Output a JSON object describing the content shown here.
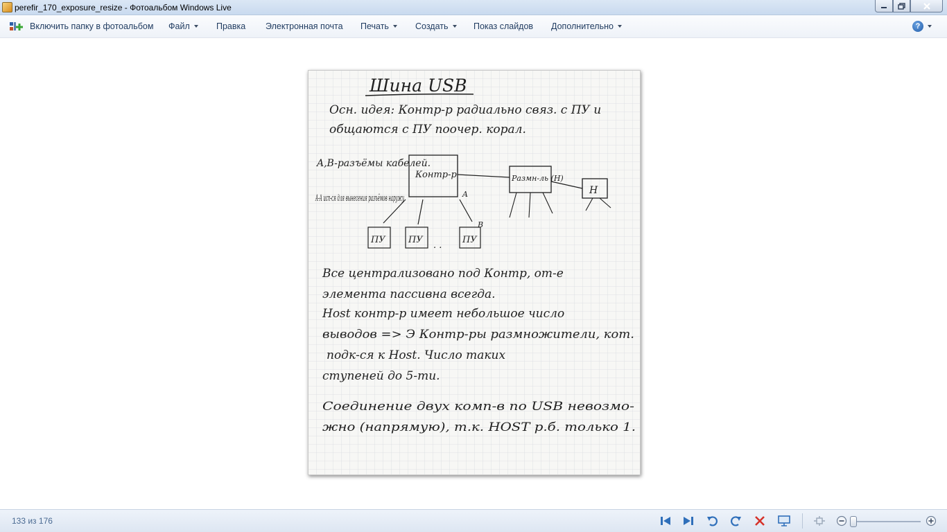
{
  "window": {
    "title": "perefir_170_exposure_resize - Фотоальбом Windows Live"
  },
  "menu": {
    "include_folder": "Включить папку в фотоальбом",
    "file": "Файл",
    "edit": "Правка",
    "email": "Электронная почта",
    "print": "Печать",
    "create": "Создать",
    "slideshow": "Показ слайдов",
    "more": "Дополнительно",
    "help": "?"
  },
  "photo": {
    "heading": "Шина USB",
    "lines": [
      "Осн. идея: Контр-р радиально связ. с ПУ и",
      "общаются с ПУ поочер. корал.",
      "Все централизовано под Контр, от-е",
      "элемента пассивна всегда.",
      "Host контр-р имеет небольшое число",
      "выводов => Э Контр-ры размножители, кот.",
      "подк-ся к Host. Число таких",
      "ступеней до 5-ти.",
      "Соединение двух комп-в по USB невозмо-",
      "жно (напрямую), т.к. HOST р.б. только 1."
    ],
    "diagram": {
      "side_note_1": "A,B-разъёмы кабелей.",
      "side_note_2": "A-A исп-ся для вынесения разъёмов наружу",
      "controller": "Контр-р",
      "hub": "Размн-ль (H)",
      "hub_small": "H",
      "pu": "ПУ",
      "label_a": "A",
      "label_b": "B",
      "ellipsis": ". ."
    }
  },
  "status": {
    "counter": "133 из 176"
  },
  "colors": {
    "accent": "#2f6fba",
    "delete": "#d6322a",
    "ink": "#1f1f1f"
  }
}
